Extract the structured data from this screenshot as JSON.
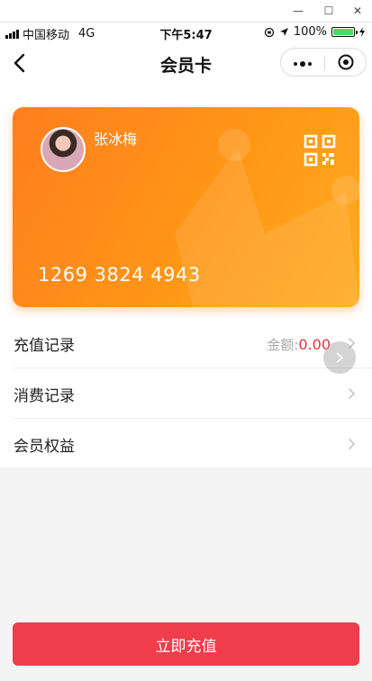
{
  "status_bar": {
    "carrier": "中国移动",
    "network": "4G",
    "time": "下午5:47",
    "battery_percent": "100%",
    "battery_level": 1.0
  },
  "nav": {
    "title": "会员卡",
    "back_icon": "chevron-left-icon",
    "more_icon": "more-dots-icon",
    "close_icon": "target-icon"
  },
  "card": {
    "holder_name": "张冰梅",
    "card_number": "1269 3824 4943",
    "qr_icon": "qr-code-icon",
    "gradient_start": "#ff7e1f",
    "gradient_end": "#ffab1f"
  },
  "menu": {
    "items": [
      {
        "label": "充值记录",
        "amount_label": "金额:",
        "amount_value": "0.00"
      },
      {
        "label": "消费记录"
      },
      {
        "label": "会员权益"
      }
    ]
  },
  "action": {
    "recharge_label": "立即充值",
    "color": "#ef3d4c"
  },
  "colors": {
    "accent_red": "#e8323c",
    "background": "#f4f4f4"
  }
}
